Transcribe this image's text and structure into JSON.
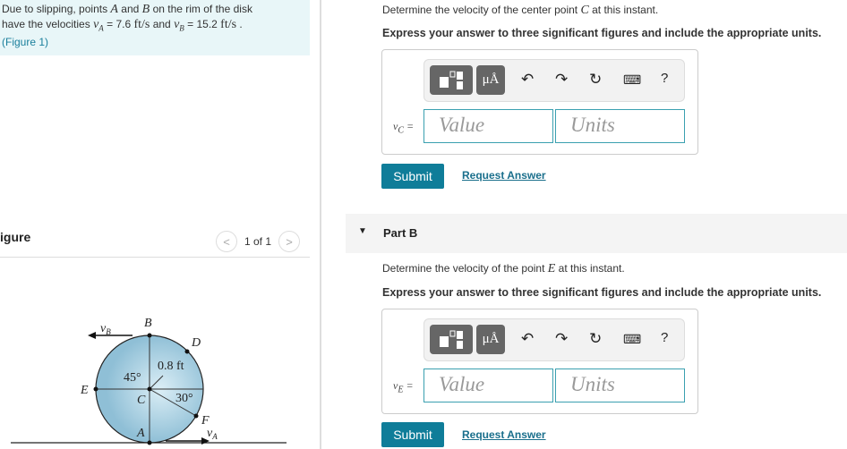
{
  "problem": {
    "text1": "Due to slipping, points ",
    "A": "A",
    "and": " and ",
    "B": "B",
    "text2": " on the rim of the disk",
    "text3": "have the velocities ",
    "vA": "v",
    "vA_sub": "A",
    "eq1": " = 7.6 ",
    "unit1": "ft/s",
    "and2": " and ",
    "vB": "v",
    "vB_sub": "B",
    "eq2": " = 15.2 ",
    "unit2": "ft/s",
    "dot": " .",
    "figure_link": "(Figure 1)"
  },
  "figure": {
    "label": "igure",
    "pager": "1 of 1",
    "prev": "<",
    "next": ">",
    "labels": {
      "vB": "v",
      "vB_sub": "B",
      "B": "B",
      "D": "D",
      "dist": "0.8 ft",
      "angle45": "45°",
      "angle30": "30°",
      "E": "E",
      "C": "C",
      "F": "F",
      "A": "A",
      "vA": "v",
      "vA_sub": "A"
    }
  },
  "partA": {
    "question": "Determine the velocity of the center point ",
    "point": "C",
    "question_end": " at this instant.",
    "instruction": "Express your answer to three significant figures and include the appropriate units.",
    "var": "v",
    "var_sub": "C",
    "eq": " =",
    "value_placeholder": "Value",
    "units_placeholder": "Units",
    "submit": "Submit",
    "request": "Request Answer"
  },
  "partB": {
    "title": "Part B",
    "question": "Determine the velocity of the point ",
    "point": "E",
    "question_end": " at this instant.",
    "instruction": "Express your answer to three significant figures and include the appropriate units.",
    "var": "v",
    "var_sub": "E",
    "eq": " =",
    "value_placeholder": "Value",
    "units_placeholder": "Units",
    "submit": "Submit",
    "request": "Request Answer"
  },
  "toolbar": {
    "units_btn": "μÅ",
    "help": "?"
  },
  "colors": {
    "accent": "#0f7d99",
    "intro_bg": "#e8f6f8",
    "disk": "#a9cfe0"
  }
}
